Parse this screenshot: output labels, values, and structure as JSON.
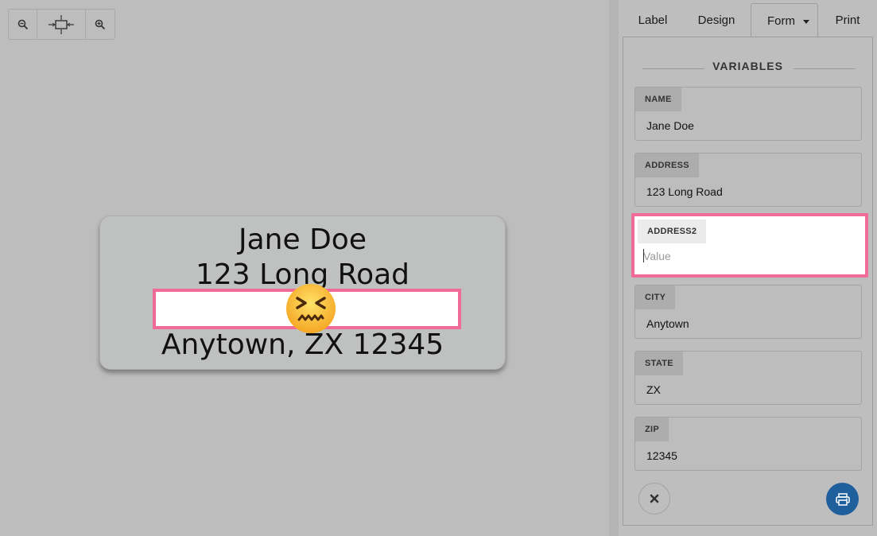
{
  "toolbar": {
    "zoom_out_icon": "zoom-out-icon",
    "fit_icon": "fit-to-screen-icon",
    "zoom_in_icon": "zoom-in-icon"
  },
  "label_preview": {
    "line1": "Jane Doe",
    "line2": "123 Long Road",
    "line3": "",
    "line4": "Anytown, ZX 12345",
    "warning_emoji": "confounded-face-icon",
    "highlight_color": "#f06b97"
  },
  "tabs": [
    {
      "label": "Label"
    },
    {
      "label": "Design"
    },
    {
      "label": "Form",
      "active": true
    },
    {
      "label": "Print"
    }
  ],
  "form": {
    "section_title": "VARIABLES",
    "fields": [
      {
        "tag": "NAME",
        "value": "Jane Doe"
      },
      {
        "tag": "ADDRESS",
        "value": "123 Long Road"
      },
      {
        "tag": "ADDRESS2",
        "value": "",
        "placeholder": "Value",
        "active": true
      },
      {
        "tag": "CITY",
        "value": "Anytown"
      },
      {
        "tag": "STATE",
        "value": "ZX"
      },
      {
        "tag": "ZIP",
        "value": "12345"
      }
    ],
    "cancel_icon": "close-icon",
    "print_icon": "printer-icon",
    "print_color": "#1f5f9c"
  }
}
